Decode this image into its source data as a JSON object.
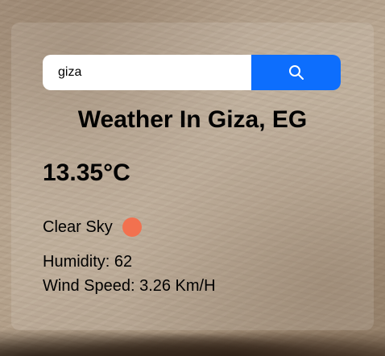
{
  "search": {
    "value": "giza",
    "placeholder": "",
    "button_icon": "search-icon"
  },
  "weather": {
    "title": "Weather In Giza, EG",
    "temperature": "13.35°C",
    "condition": "Clear Sky",
    "condition_icon": "sun-icon",
    "humidity": "Humidity: 62",
    "wind": "Wind Speed: 3.26 Km/H"
  },
  "colors": {
    "accent": "#0d6efd",
    "sun": "#f2714f"
  }
}
